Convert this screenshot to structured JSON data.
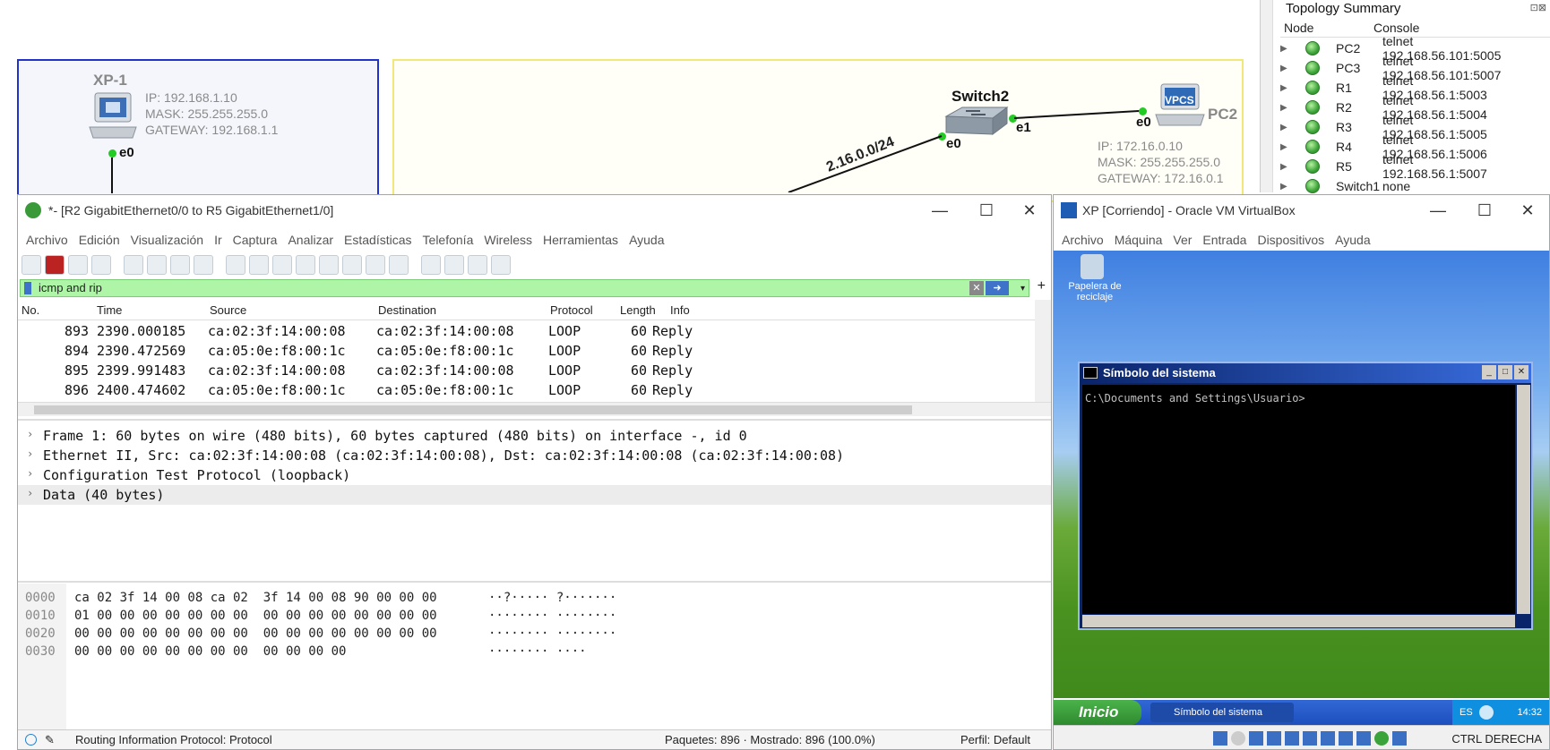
{
  "gns3": {
    "xp1": {
      "name": "XP-1",
      "ip": "IP: 192.168.1.10",
      "mask": "MASK: 255.255.255.0",
      "gateway": "GATEWAY: 192.168.1.1",
      "iface": "e0"
    },
    "switch2": {
      "name": "Switch2",
      "iface_left": "e0",
      "iface_right": "e1"
    },
    "pc2": {
      "name": "PC2",
      "badge": "VPCS",
      "iface": "e0",
      "ip": "IP: 172.16.0.10",
      "mask": "MASK: 255.255.255.0",
      "gateway": "GATEWAY: 172.16.0.1"
    },
    "link_label": "2.16.0.0/24"
  },
  "topology": {
    "title": "Topology Summary",
    "headers": {
      "node": "Node",
      "console": "Console"
    },
    "rows": [
      {
        "node": "PC2",
        "console": "telnet 192.168.56.101:5005"
      },
      {
        "node": "PC3",
        "console": "telnet 192.168.56.101:5007"
      },
      {
        "node": "R1",
        "console": "telnet 192.168.56.1:5003"
      },
      {
        "node": "R2",
        "console": "telnet 192.168.56.1:5004"
      },
      {
        "node": "R3",
        "console": "telnet 192.168.56.1:5005"
      },
      {
        "node": "R4",
        "console": "telnet 192.168.56.1:5006"
      },
      {
        "node": "R5",
        "console": "telnet 192.168.56.1:5007"
      },
      {
        "node": "Switch1",
        "console": "none"
      }
    ]
  },
  "wireshark": {
    "title": "*- [R2 GigabitEthernet0/0 to R5 GigabitEthernet1/0]",
    "menu": [
      "Archivo",
      "Edición",
      "Visualización",
      "Ir",
      "Captura",
      "Analizar",
      "Estadísticas",
      "Telefonía",
      "Wireless",
      "Herramientas",
      "Ayuda"
    ],
    "filter": "icmp and rip",
    "columns": {
      "no": "No.",
      "time": "Time",
      "source": "Source",
      "destination": "Destination",
      "protocol": "Protocol",
      "length": "Length",
      "info": "Info"
    },
    "packets": [
      {
        "no": "893",
        "time": "2390.000185",
        "source": "ca:02:3f:14:00:08",
        "destination": "ca:02:3f:14:00:08",
        "protocol": "LOOP",
        "length": "60",
        "info": "Reply"
      },
      {
        "no": "894",
        "time": "2390.472569",
        "source": "ca:05:0e:f8:00:1c",
        "destination": "ca:05:0e:f8:00:1c",
        "protocol": "LOOP",
        "length": "60",
        "info": "Reply"
      },
      {
        "no": "895",
        "time": "2399.991483",
        "source": "ca:02:3f:14:00:08",
        "destination": "ca:02:3f:14:00:08",
        "protocol": "LOOP",
        "length": "60",
        "info": "Reply"
      },
      {
        "no": "896",
        "time": "2400.474602",
        "source": "ca:05:0e:f8:00:1c",
        "destination": "ca:05:0e:f8:00:1c",
        "protocol": "LOOP",
        "length": "60",
        "info": "Reply"
      }
    ],
    "details": [
      "Frame 1: 60 bytes on wire (480 bits), 60 bytes captured (480 bits) on interface -, id 0",
      "Ethernet II, Src: ca:02:3f:14:00:08 (ca:02:3f:14:00:08), Dst: ca:02:3f:14:00:08 (ca:02:3f:14:00:08)",
      "Configuration Test Protocol (loopback)",
      "Data (40 bytes)"
    ],
    "hex": [
      {
        "offset": "0000",
        "bytes": "ca 02 3f 14 00 08 ca 02  3f 14 00 08 90 00 00 00",
        "ascii": "··?····· ?·······"
      },
      {
        "offset": "0010",
        "bytes": "01 00 00 00 00 00 00 00  00 00 00 00 00 00 00 00",
        "ascii": "········ ········"
      },
      {
        "offset": "0020",
        "bytes": "00 00 00 00 00 00 00 00  00 00 00 00 00 00 00 00",
        "ascii": "········ ········"
      },
      {
        "offset": "0030",
        "bytes": "00 00 00 00 00 00 00 00  00 00 00 00",
        "ascii": "········ ····"
      }
    ],
    "status": {
      "field": "Routing Information Protocol: Protocol",
      "packets": "Paquetes: 896 · Mostrado: 896 (100.0%)",
      "profile": "Perfil: Default"
    }
  },
  "virtualbox": {
    "title": "XP [Corriendo] - Oracle VM VirtualBox",
    "menu": [
      "Archivo",
      "Máquina",
      "Ver",
      "Entrada",
      "Dispositivos",
      "Ayuda"
    ],
    "recycle": "Papelera de reciclaje",
    "cmd_title": "Símbolo del sistema",
    "cmd_prompt": "C:\\Documents and Settings\\Usuario>",
    "start": "Inicio",
    "task": "Símbolo del sistema",
    "lang": "ES",
    "clock": "14:32",
    "hostkey": "CTRL DERECHA"
  }
}
